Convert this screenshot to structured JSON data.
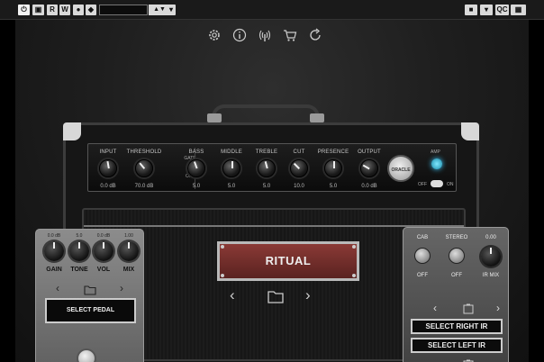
{
  "host_toolbar": {
    "power_label": "⏻",
    "r_label": "R",
    "w_label": "W",
    "preset_field": "",
    "qc_label": "QC"
  },
  "top_icons": [
    "gear-icon",
    "info-icon",
    "broadcast-icon",
    "cart-icon",
    "refresh-icon"
  ],
  "amp": {
    "controls": [
      {
        "label": "INPUT",
        "value": "0.0 dB"
      },
      {
        "label": "THRESHOLD",
        "value": "70.0 dB"
      },
      {
        "label": "BASS",
        "value": "5.0"
      },
      {
        "label": "MIDDLE",
        "value": "5.0"
      },
      {
        "label": "TREBLE",
        "value": "5.0"
      },
      {
        "label": "CUT",
        "value": "10.0"
      },
      {
        "label": "PRESENCE",
        "value": "5.0"
      },
      {
        "label": "OUTPUT",
        "value": "0.0 dB"
      }
    ],
    "gate_label": "GATE",
    "gate_off_label": "OFF",
    "logo_text": "ORACLE",
    "amp_label": "AMP",
    "amp_off_label": "OFF",
    "amp_on_label": "ON",
    "preset_name": "RITUAL"
  },
  "left_pedal": {
    "controls": [
      {
        "label": "GAIN",
        "value": "0.0 dB"
      },
      {
        "label": "TONE",
        "value": "5.0"
      },
      {
        "label": "VOL",
        "value": "0.0 dB"
      },
      {
        "label": "MIX",
        "value": "1.00"
      }
    ],
    "select_label": "SELECT PEDAL"
  },
  "right_pedal": {
    "cab_label": "CAB",
    "cab_state": "OFF",
    "stereo_label": "STEREO",
    "stereo_state": "OFF",
    "irmix_value": "0.00",
    "irmix_label": "IR MIX",
    "select_right": "SELECT RIGHT IR",
    "select_left": "SELECT LEFT IR"
  }
}
